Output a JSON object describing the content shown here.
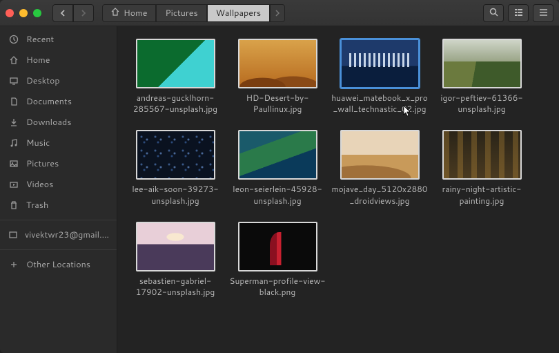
{
  "breadcrumb": {
    "home": "Home",
    "pictures": "Pictures",
    "current": "Wallpapers"
  },
  "sidebar": [
    {
      "icon": "clock",
      "label": "Recent"
    },
    {
      "icon": "home",
      "label": "Home"
    },
    {
      "icon": "desktop",
      "label": "Desktop"
    },
    {
      "icon": "doc",
      "label": "Documents"
    },
    {
      "icon": "download",
      "label": "Downloads"
    },
    {
      "icon": "music",
      "label": "Music"
    },
    {
      "icon": "picture",
      "label": "Pictures"
    },
    {
      "icon": "video",
      "label": "Videos"
    },
    {
      "icon": "trash",
      "label": "Trash"
    }
  ],
  "accounts": [
    {
      "icon": "mail",
      "label": "vivektwr23@gmail...."
    }
  ],
  "bottom": [
    {
      "icon": "plus",
      "label": "Other Locations"
    }
  ],
  "files": [
    {
      "name": "andreas-gucklhorn-285567-unsplash.jpg",
      "selected": false
    },
    {
      "name": "HD-Desert-by-Paullinux.jpg",
      "selected": false
    },
    {
      "name": "huawei_matebook_x_pro_wall_technastic_02.jpg",
      "selected": true
    },
    {
      "name": "igor-peftiev-61366-unsplash.jpg",
      "selected": false
    },
    {
      "name": "lee-aik-soon-39273-unsplash.jpg",
      "selected": false
    },
    {
      "name": "leon-seierlein-45928-unsplash.jpg",
      "selected": false
    },
    {
      "name": "mojave_day_5120x2880_droidviews.jpg",
      "selected": false
    },
    {
      "name": "rainy-night-artistic-painting.jpg",
      "selected": false
    },
    {
      "name": "sebastien-gabriel-17902-unsplash.jpg",
      "selected": false
    },
    {
      "name": "Superman-profile-view-black.png",
      "selected": false
    }
  ]
}
